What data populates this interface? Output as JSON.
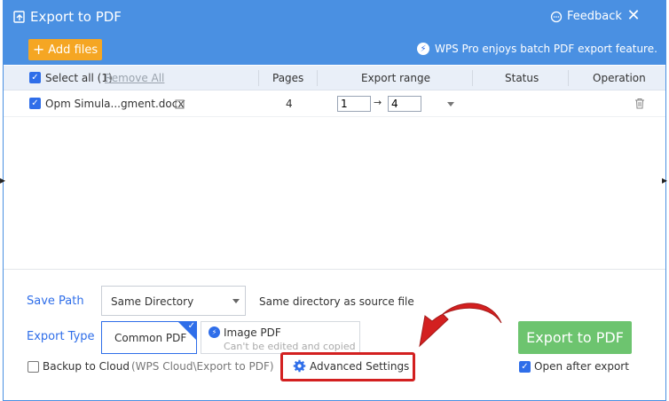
{
  "window": {
    "title": "Export to PDF",
    "feedback": "Feedback",
    "close_glyph": "✕"
  },
  "toolbar": {
    "add_files_label": "Add files",
    "promo": "WPS Pro enjoys batch PDF export feature."
  },
  "table": {
    "select_all": "Select all (1)",
    "remove_all": "Remove All",
    "headers": {
      "pages": "Pages",
      "export_range": "Export range",
      "status": "Status",
      "operation": "Operation"
    },
    "rows": [
      {
        "name": "Opm Simula...gment.docx",
        "pages": "4",
        "range_from": "1",
        "range_to": "4",
        "status": ""
      }
    ]
  },
  "settings": {
    "save_path_label": "Save Path",
    "save_path_value": "Same Directory",
    "save_path_hint": "Same directory as source file",
    "export_type_label": "Export Type",
    "common_pdf": "Common PDF",
    "image_pdf": "Image PDF",
    "image_pdf_sub": "Can't be edited and copied",
    "backup_label": "Backup to Cloud",
    "backup_path": "(WPS Cloud\\Export to PDF)",
    "advanced": "Advanced Settings",
    "export_button": "Export to PDF",
    "open_after": "Open after export"
  },
  "colors": {
    "header": "#4a90e2",
    "accent": "#2f6ee9",
    "add_files": "#f5a623",
    "export": "#6dc46f",
    "highlight": "#d32020"
  }
}
